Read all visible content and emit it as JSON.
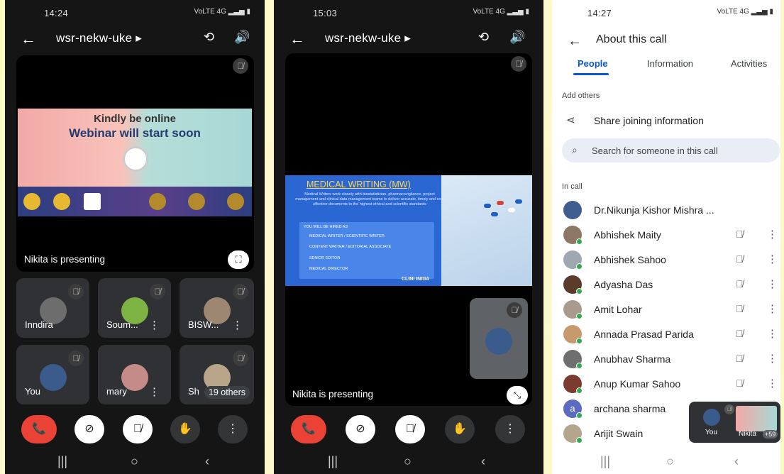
{
  "phone1": {
    "status_time": "14:24",
    "status_right": "VoLTE 4G ▂▃▅ ▮",
    "meeting_code": "wsr-nekw-uke",
    "slide": {
      "line1": "Kindly be online",
      "line2": "Webinar will start soon"
    },
    "presenting": "Nikita is presenting",
    "tiles": [
      {
        "name": "Inndira",
        "color": "#6d6d6d"
      },
      {
        "name": "Soum...",
        "color": "#7cb342"
      },
      {
        "name": "BISW...",
        "color": "#9e8772"
      },
      {
        "name": "You",
        "color": "#3b5b8c"
      },
      {
        "name": "mary",
        "color": "#c58b88"
      },
      {
        "name": "Sh",
        "color": "#b8a58a"
      }
    ],
    "others": "19 others"
  },
  "phone2": {
    "status_time": "15:03",
    "status_right": "VoLTE 4G ▂▃▅ ▮",
    "meeting_code": "wsr-nekw-uke",
    "slide": {
      "heading": "MEDICAL WRITING (MW)",
      "desc": "Medical Writers work closely with biostatistician, pharmacovigilance, project management and clinical data management teams to deliver accurate, timely and cost effective documents to the highest ethical and scientific standards",
      "hired": "YOU WILL BE HIRED AS",
      "roles": [
        "MEDICAL WRITER / SCIENTIFIC WRITER",
        "CONTENT WRITER / EDITORIAL ASSOCIATE",
        "SENIOR EDITOR",
        "MEDICAL DIRECTOR"
      ],
      "brand": "CLINI INDIA"
    },
    "presenting": "Nikita is presenting"
  },
  "phone3": {
    "status_time": "14:27",
    "status_right": "VoLTE 4G ▂▃▅ ▮",
    "title": "About this call",
    "tabs": [
      "People",
      "Information",
      "Activities"
    ],
    "add_others": "Add others",
    "share": "Share joining information",
    "search_placeholder": "Search for someone in this call",
    "in_call": "In call",
    "people": [
      {
        "name": "Dr.Nikunja Kishor Mishra ...",
        "color": "#3f5e8f"
      },
      {
        "name": "Abhishek Maity",
        "color": "#8d7866"
      },
      {
        "name": "Abhishek Sahoo",
        "color": "#9fa7b0"
      },
      {
        "name": "Adyasha Das",
        "color": "#5a3b2c"
      },
      {
        "name": "Amit Lohar",
        "color": "#a89a8c"
      },
      {
        "name": "Annada Prasad Parida",
        "color": "#c79a6d"
      },
      {
        "name": "Anubhav Sharma",
        "color": "#6f6f6f"
      },
      {
        "name": "Anup Kumar Sahoo",
        "color": "#7b3b2f"
      },
      {
        "name": "archana sharma",
        "color": "#5c6bc0",
        "initial": "a"
      },
      {
        "name": "Arijit Swain",
        "color": "#b5a48e"
      }
    ],
    "pip": {
      "you": "You",
      "nikita": "Nikita",
      "more": "+59"
    }
  },
  "nav": {
    "recents": "|||",
    "home": "○",
    "back": "‹"
  }
}
